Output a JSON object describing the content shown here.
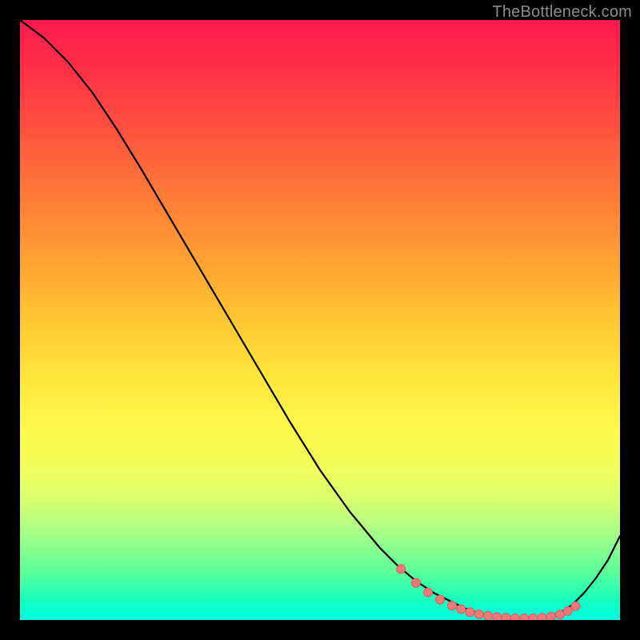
{
  "attribution": "TheBottleneck.com",
  "colors": {
    "dot_fill": "#f07878",
    "dot_stroke": "#d85f5f",
    "curve_stroke": "#000000"
  },
  "chart_data": {
    "type": "line",
    "title": "",
    "xlabel": "",
    "ylabel": "",
    "xlim": [
      0,
      100
    ],
    "ylim": [
      0,
      100
    ],
    "x": [
      0,
      4,
      8,
      12,
      16,
      20,
      25,
      30,
      35,
      40,
      45,
      50,
      55,
      60,
      63,
      66,
      69,
      72,
      74,
      76,
      78,
      80,
      82,
      84,
      86,
      88,
      90,
      92,
      94,
      96,
      98,
      100
    ],
    "values": [
      100,
      97,
      93,
      88,
      82,
      75.5,
      67,
      58.5,
      50,
      41.5,
      33,
      25,
      18,
      12,
      9,
      6.5,
      4.5,
      3,
      2,
      1.3,
      0.8,
      0.5,
      0.3,
      0.25,
      0.3,
      0.6,
      1.2,
      2.5,
      4.5,
      7,
      10,
      14
    ],
    "dots_x": [
      63.5,
      66,
      68,
      70,
      72,
      73.5,
      75,
      76.5,
      78,
      79.5,
      81,
      82.5,
      84,
      85.5,
      87,
      88.5,
      90,
      91.3,
      92.6
    ],
    "dots_y": [
      8.5,
      6.2,
      4.6,
      3.4,
      2.4,
      1.8,
      1.3,
      0.95,
      0.7,
      0.5,
      0.38,
      0.3,
      0.26,
      0.28,
      0.38,
      0.55,
      0.9,
      1.5,
      2.3
    ]
  }
}
